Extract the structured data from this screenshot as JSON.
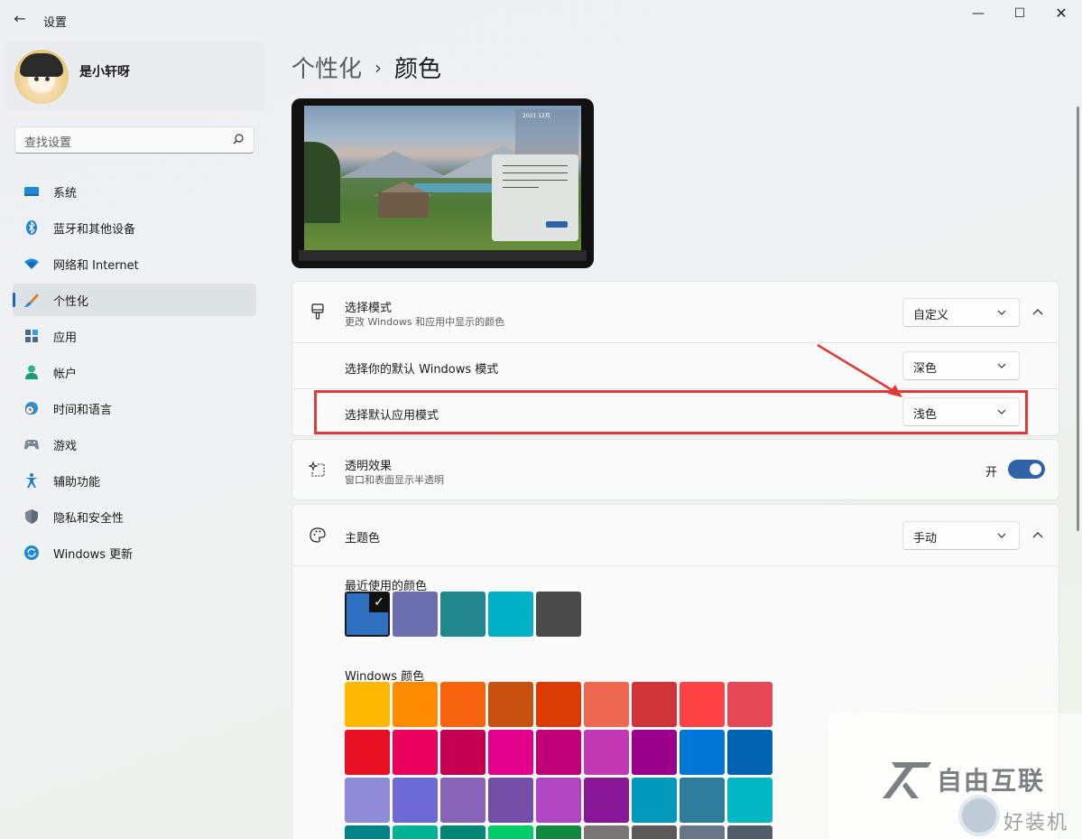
{
  "window": {
    "title": "设置",
    "back_glyph": "←",
    "minimize_glyph": "—",
    "maximize_glyph": "☐",
    "close_glyph": "✕"
  },
  "profile": {
    "name": "是小轩呀"
  },
  "search": {
    "placeholder": "查找设置"
  },
  "nav": {
    "items": [
      {
        "label": "系统",
        "icon": "monitor-icon"
      },
      {
        "label": "蓝牙和其他设备",
        "icon": "bluetooth-icon"
      },
      {
        "label": "网络和 Internet",
        "icon": "wifi-icon"
      },
      {
        "label": "个性化",
        "icon": "brush-icon",
        "active": true
      },
      {
        "label": "应用",
        "icon": "apps-icon"
      },
      {
        "label": "帐户",
        "icon": "person-icon"
      },
      {
        "label": "时间和语言",
        "icon": "globe-clock-icon"
      },
      {
        "label": "游戏",
        "icon": "gamepad-icon"
      },
      {
        "label": "辅助功能",
        "icon": "accessibility-icon"
      },
      {
        "label": "隐私和安全性",
        "icon": "shield-icon"
      },
      {
        "label": "Windows 更新",
        "icon": "update-icon"
      }
    ]
  },
  "breadcrumb": {
    "parent": "个性化",
    "separator": "›",
    "current": "颜色"
  },
  "preview": {
    "calendar_header": "2021 12月"
  },
  "mode": {
    "title": "选择模式",
    "subtitle": "更改 Windows 和应用中显示的颜色",
    "value": "自定义",
    "windows_mode_label": "选择你的默认 Windows 模式",
    "windows_mode_value": "深色",
    "app_mode_label": "选择默认应用模式",
    "app_mode_value": "浅色"
  },
  "transparency": {
    "title": "透明效果",
    "subtitle": "窗口和表面显示半透明",
    "state_label": "开",
    "enabled": true
  },
  "accent": {
    "title": "主题色",
    "value": "手动",
    "recent_label": "最近使用的颜色",
    "recent_colors": [
      "#2f6fbf",
      "#6b6fb0",
      "#22868f",
      "#00b0c4",
      "#4a4a4a"
    ],
    "recent_selected_index": 0,
    "check_glyph": "✓",
    "windows_label": "Windows 颜色",
    "windows_colors": [
      [
        "#ffb900",
        "#ff8c00",
        "#f7630c",
        "#ca5010",
        "#da3b01",
        "#ef6950",
        "#d13438",
        "#ff4343",
        "#e74856"
      ],
      [
        "#e81123",
        "#ea005e",
        "#c30052",
        "#e3008c",
        "#bf0077",
        "#c239b3",
        "#9a0089",
        "#0078d7",
        "#0063b1"
      ],
      [
        "#8e8cd8",
        "#6b69d6",
        "#8764b8",
        "#744da9",
        "#b146c2",
        "#881798",
        "#0099bc",
        "#2d7d9a",
        "#00b7c3"
      ],
      [
        "#038387",
        "#00b294",
        "#018574",
        "#00cc6a",
        "#10893e",
        "#7a7574",
        "#5d5a58",
        "#68768a",
        "#515c6b"
      ]
    ]
  },
  "watermark": {
    "brand": "自由互联",
    "site": "好装机"
  },
  "colors": {
    "accent": "#2f62a6",
    "highlight": "#e03a3a"
  }
}
